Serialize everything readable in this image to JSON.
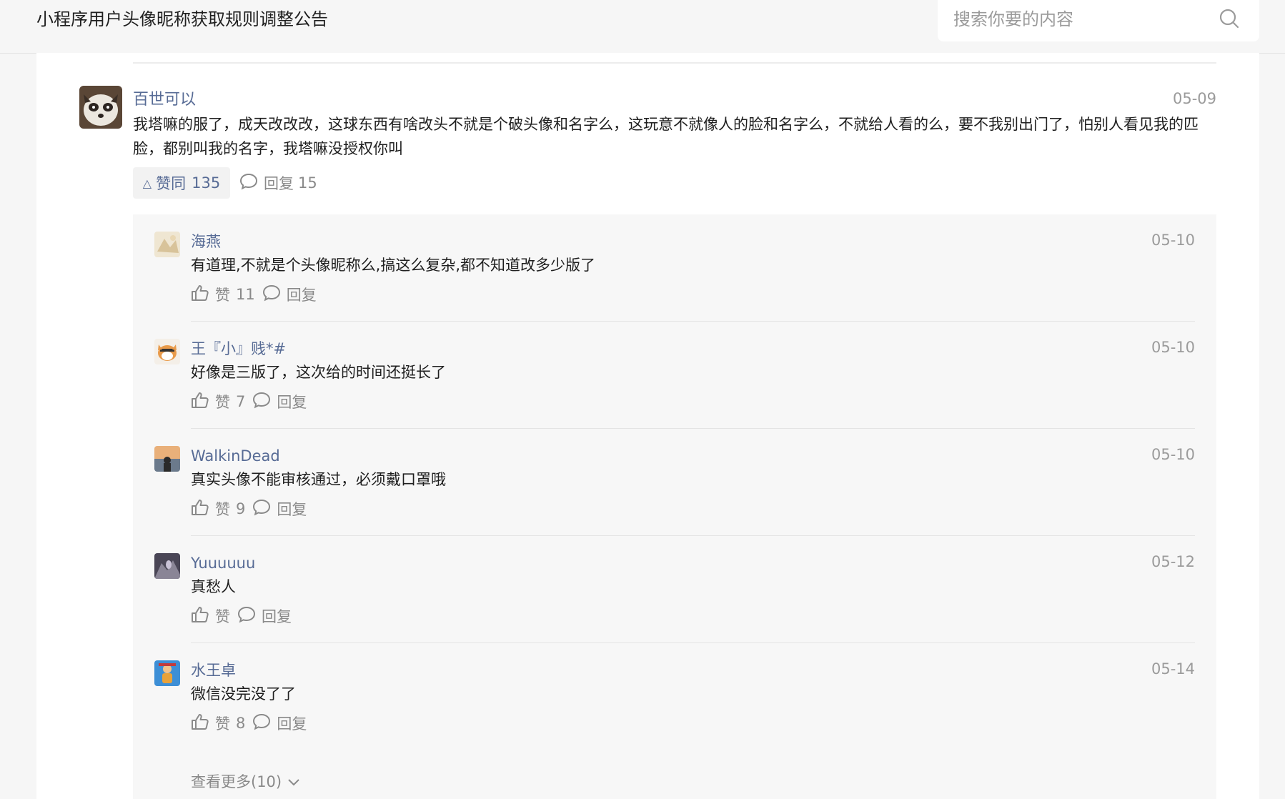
{
  "header": {
    "title": "小程序用户头像昵称获取规则调整公告",
    "search_placeholder": "搜索你要的内容"
  },
  "main_comment": {
    "author": "百世可以",
    "date": "05-09",
    "text": "我塔嘛的服了，成天改改改，这球东西有啥改头不就是个破头像和名字么，这玩意不就像人的脸和名字么，不就给人看的么，要不我别出门了，怕别人看见我的匹脸，都别叫我的名字，我塔嘛没授权你叫",
    "like_label": "赞同",
    "like_count": "135",
    "reply_label": "回复",
    "reply_count": "15"
  },
  "replies": [
    {
      "author": "海燕",
      "date": "05-10",
      "text": "有道理,不就是个头像昵称么,搞这么复杂,都不知道改多少版了",
      "like_label": "赞",
      "like_count": "11",
      "reply_label": "回复"
    },
    {
      "author": "王『小』贱*#",
      "date": "05-10",
      "text": "好像是三版了，这次给的时间还挺长了",
      "like_label": "赞",
      "like_count": "7",
      "reply_label": "回复"
    },
    {
      "author": "WalkinDead",
      "date": "05-10",
      "text": "真实头像不能审核通过，必须戴口罩哦",
      "like_label": "赞",
      "like_count": "9",
      "reply_label": "回复"
    },
    {
      "author": "Yuuuuuu",
      "date": "05-12",
      "text": "真愁人",
      "like_label": "赞",
      "like_count": "",
      "reply_label": "回复"
    },
    {
      "author": "水王卓",
      "date": "05-14",
      "text": "微信没完没了了",
      "like_label": "赞",
      "like_count": "8",
      "reply_label": "回复"
    }
  ],
  "more_replies_label": "查看更多(10)",
  "colors": {
    "link": "#576b95",
    "muted": "#9b9b9b",
    "text": "#1f1f1f",
    "page_bg": "#f6f6f6",
    "reply_bg": "#f7f7f7"
  },
  "icons": {
    "search": "search-icon",
    "like": "thumb-up-icon",
    "comment": "comment-bubble-icon",
    "expand": "chevron-down-icon"
  }
}
